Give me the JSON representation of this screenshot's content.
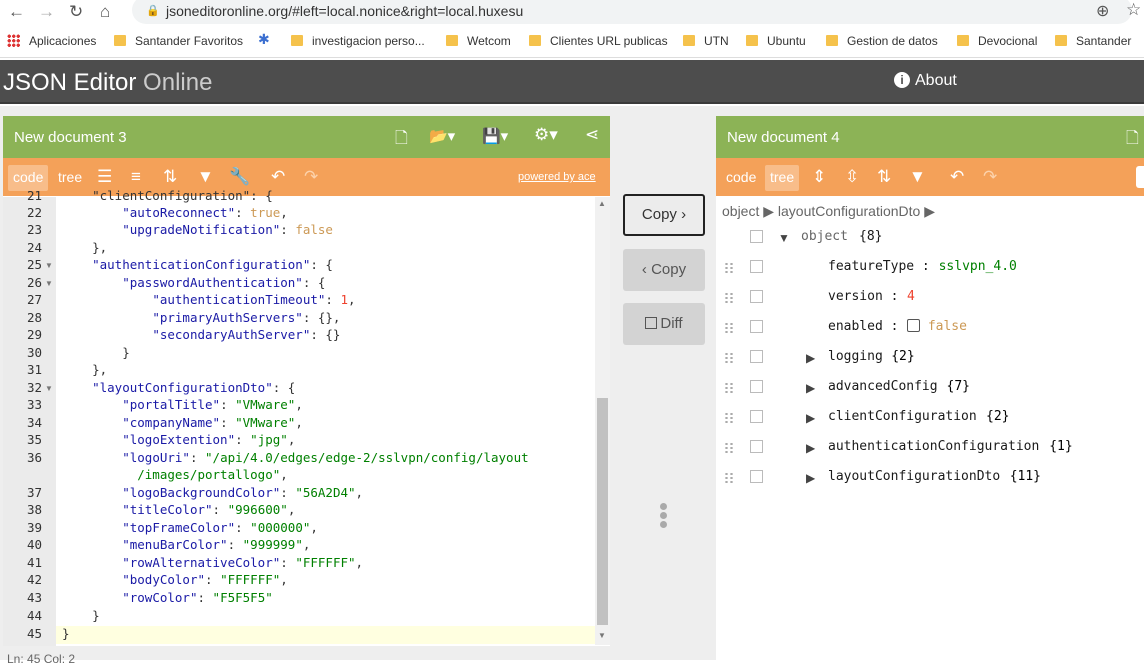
{
  "browser": {
    "url": "jsoneditoronline.org/#left=local.nonice&right=local.huxesu",
    "bookmarks": [
      "Aplicaciones",
      "Santander Favoritos",
      "investigacion perso...",
      "Wetcom",
      "Clientes URL publicas",
      "UTN",
      "Ubuntu",
      "Gestion de datos",
      "Devocional",
      "Santander"
    ]
  },
  "app": {
    "title_main": "JSON Editor",
    "title_thin": "Online",
    "about_label": "About"
  },
  "left_panel": {
    "title": "New document 3",
    "mode_code": "code",
    "mode_tree": "tree",
    "powered_by": "powered by ace",
    "lines": [
      {
        "n": "21",
        "parts": [
          [
            "",
            "    \"clientConfiguration\": {"
          ]
        ]
      },
      {
        "n": "22",
        "parts": [
          [
            "",
            "        "
          ],
          [
            "k",
            "\"autoReconnect\""
          ],
          [
            "",
            ": "
          ],
          [
            "b",
            "true"
          ],
          [
            "",
            ","
          ]
        ]
      },
      {
        "n": "23",
        "parts": [
          [
            "",
            "        "
          ],
          [
            "k",
            "\"upgradeNotification\""
          ],
          [
            "",
            ": "
          ],
          [
            "b",
            "false"
          ]
        ]
      },
      {
        "n": "24",
        "parts": [
          [
            "",
            "    },"
          ]
        ]
      },
      {
        "n": "25",
        "fold": true,
        "parts": [
          [
            "",
            "    "
          ],
          [
            "k",
            "\"authenticationConfiguration\""
          ],
          [
            "",
            ": {"
          ]
        ]
      },
      {
        "n": "26",
        "fold": true,
        "parts": [
          [
            "",
            "        "
          ],
          [
            "k",
            "\"passwordAuthentication\""
          ],
          [
            "",
            ": {"
          ]
        ]
      },
      {
        "n": "27",
        "parts": [
          [
            "",
            "            "
          ],
          [
            "k",
            "\"authenticationTimeout\""
          ],
          [
            "",
            ": "
          ],
          [
            "n",
            "1"
          ],
          [
            "",
            ","
          ]
        ]
      },
      {
        "n": "28",
        "parts": [
          [
            "",
            "            "
          ],
          [
            "k",
            "\"primaryAuthServers\""
          ],
          [
            "",
            ": {},"
          ]
        ]
      },
      {
        "n": "29",
        "parts": [
          [
            "",
            "            "
          ],
          [
            "k",
            "\"secondaryAuthServer\""
          ],
          [
            "",
            ": {}"
          ]
        ]
      },
      {
        "n": "30",
        "parts": [
          [
            "",
            "        }"
          ]
        ]
      },
      {
        "n": "31",
        "parts": [
          [
            "",
            "    },"
          ]
        ]
      },
      {
        "n": "32",
        "fold": true,
        "parts": [
          [
            "",
            "    "
          ],
          [
            "k",
            "\"layoutConfigurationDto\""
          ],
          [
            "",
            ": {"
          ]
        ]
      },
      {
        "n": "33",
        "parts": [
          [
            "",
            "        "
          ],
          [
            "k",
            "\"portalTitle\""
          ],
          [
            "",
            ": "
          ],
          [
            "s",
            "\"VMware\""
          ],
          [
            "",
            ","
          ]
        ]
      },
      {
        "n": "34",
        "parts": [
          [
            "",
            "        "
          ],
          [
            "k",
            "\"companyName\""
          ],
          [
            "",
            ": "
          ],
          [
            "s",
            "\"VMware\""
          ],
          [
            "",
            ","
          ]
        ]
      },
      {
        "n": "35",
        "parts": [
          [
            "",
            "        "
          ],
          [
            "k",
            "\"logoExtention\""
          ],
          [
            "",
            ": "
          ],
          [
            "s",
            "\"jpg\""
          ],
          [
            "",
            ","
          ]
        ]
      },
      {
        "n": "36",
        "parts": [
          [
            "",
            "        "
          ],
          [
            "k",
            "\"logoUri\""
          ],
          [
            "",
            ": "
          ],
          [
            "s",
            "\"/api/4.0/edges/edge-2/sslvpn/config/layout"
          ]
        ]
      },
      {
        "n": "",
        "parts": [
          [
            "s",
            "          /images/portallogo\""
          ],
          [
            "",
            ","
          ]
        ]
      },
      {
        "n": "37",
        "parts": [
          [
            "",
            "        "
          ],
          [
            "k",
            "\"logoBackgroundColor\""
          ],
          [
            "",
            ": "
          ],
          [
            "s",
            "\"56A2D4\""
          ],
          [
            "",
            ","
          ]
        ]
      },
      {
        "n": "38",
        "parts": [
          [
            "",
            "        "
          ],
          [
            "k",
            "\"titleColor\""
          ],
          [
            "",
            ": "
          ],
          [
            "s",
            "\"996600\""
          ],
          [
            "",
            ","
          ]
        ]
      },
      {
        "n": "39",
        "parts": [
          [
            "",
            "        "
          ],
          [
            "k",
            "\"topFrameColor\""
          ],
          [
            "",
            ": "
          ],
          [
            "s",
            "\"000000\""
          ],
          [
            "",
            ","
          ]
        ]
      },
      {
        "n": "40",
        "parts": [
          [
            "",
            "        "
          ],
          [
            "k",
            "\"menuBarColor\""
          ],
          [
            "",
            ": "
          ],
          [
            "s",
            "\"999999\""
          ],
          [
            "",
            ","
          ]
        ]
      },
      {
        "n": "41",
        "parts": [
          [
            "",
            "        "
          ],
          [
            "k",
            "\"rowAlternativeColor\""
          ],
          [
            "",
            ": "
          ],
          [
            "s",
            "\"FFFFFF\""
          ],
          [
            "",
            ","
          ]
        ]
      },
      {
        "n": "42",
        "parts": [
          [
            "",
            "        "
          ],
          [
            "k",
            "\"bodyColor\""
          ],
          [
            "",
            ": "
          ],
          [
            "s",
            "\"FFFFFF\""
          ],
          [
            "",
            ","
          ]
        ]
      },
      {
        "n": "43",
        "parts": [
          [
            "",
            "        "
          ],
          [
            "k",
            "\"rowColor\""
          ],
          [
            "",
            ": "
          ],
          [
            "s",
            "\"F5F5F5\""
          ]
        ]
      },
      {
        "n": "44",
        "parts": [
          [
            "",
            "    }"
          ]
        ]
      },
      {
        "n": "45",
        "parts": [
          [
            "",
            "}"
          ]
        ]
      }
    ],
    "status": "Ln: 45    Col: 2"
  },
  "middle": {
    "copy_right": "Copy",
    "copy_left": "Copy",
    "diff": "Diff"
  },
  "right_panel": {
    "title": "New document 4",
    "mode_code": "code",
    "mode_tree": "tree",
    "breadcrumb": "object ▶ layoutConfigurationDto ▶",
    "root_label": "object",
    "root_count": "{8}",
    "rows": [
      {
        "key": "featureType",
        "sep": " : ",
        "value": "sslvpn_4.0",
        "vclass": "s",
        "expand": false
      },
      {
        "key": "version",
        "sep": " : ",
        "value": "4",
        "vclass": "n",
        "expand": false
      },
      {
        "key": "enabled",
        "sep": " : ",
        "value": "false",
        "vclass": "b",
        "expand": false,
        "checkbox": true
      },
      {
        "key": "logging",
        "sep": " ",
        "value": "{2}",
        "vclass": "c",
        "expand": true
      },
      {
        "key": "advancedConfig",
        "sep": " ",
        "value": "{7}",
        "vclass": "c",
        "expand": true
      },
      {
        "key": "clientConfiguration",
        "sep": " ",
        "value": "{2}",
        "vclass": "c",
        "expand": true
      },
      {
        "key": "authenticationConfiguration",
        "sep": " ",
        "value": "{1}",
        "vclass": "c",
        "expand": true
      },
      {
        "key": "layoutConfigurationDto",
        "sep": " ",
        "value": "{11}",
        "vclass": "c",
        "expand": true
      }
    ]
  },
  "colors": {
    "header": "#4d4d4d",
    "panel_title": "#8cb356",
    "menu": "#f4a159"
  }
}
